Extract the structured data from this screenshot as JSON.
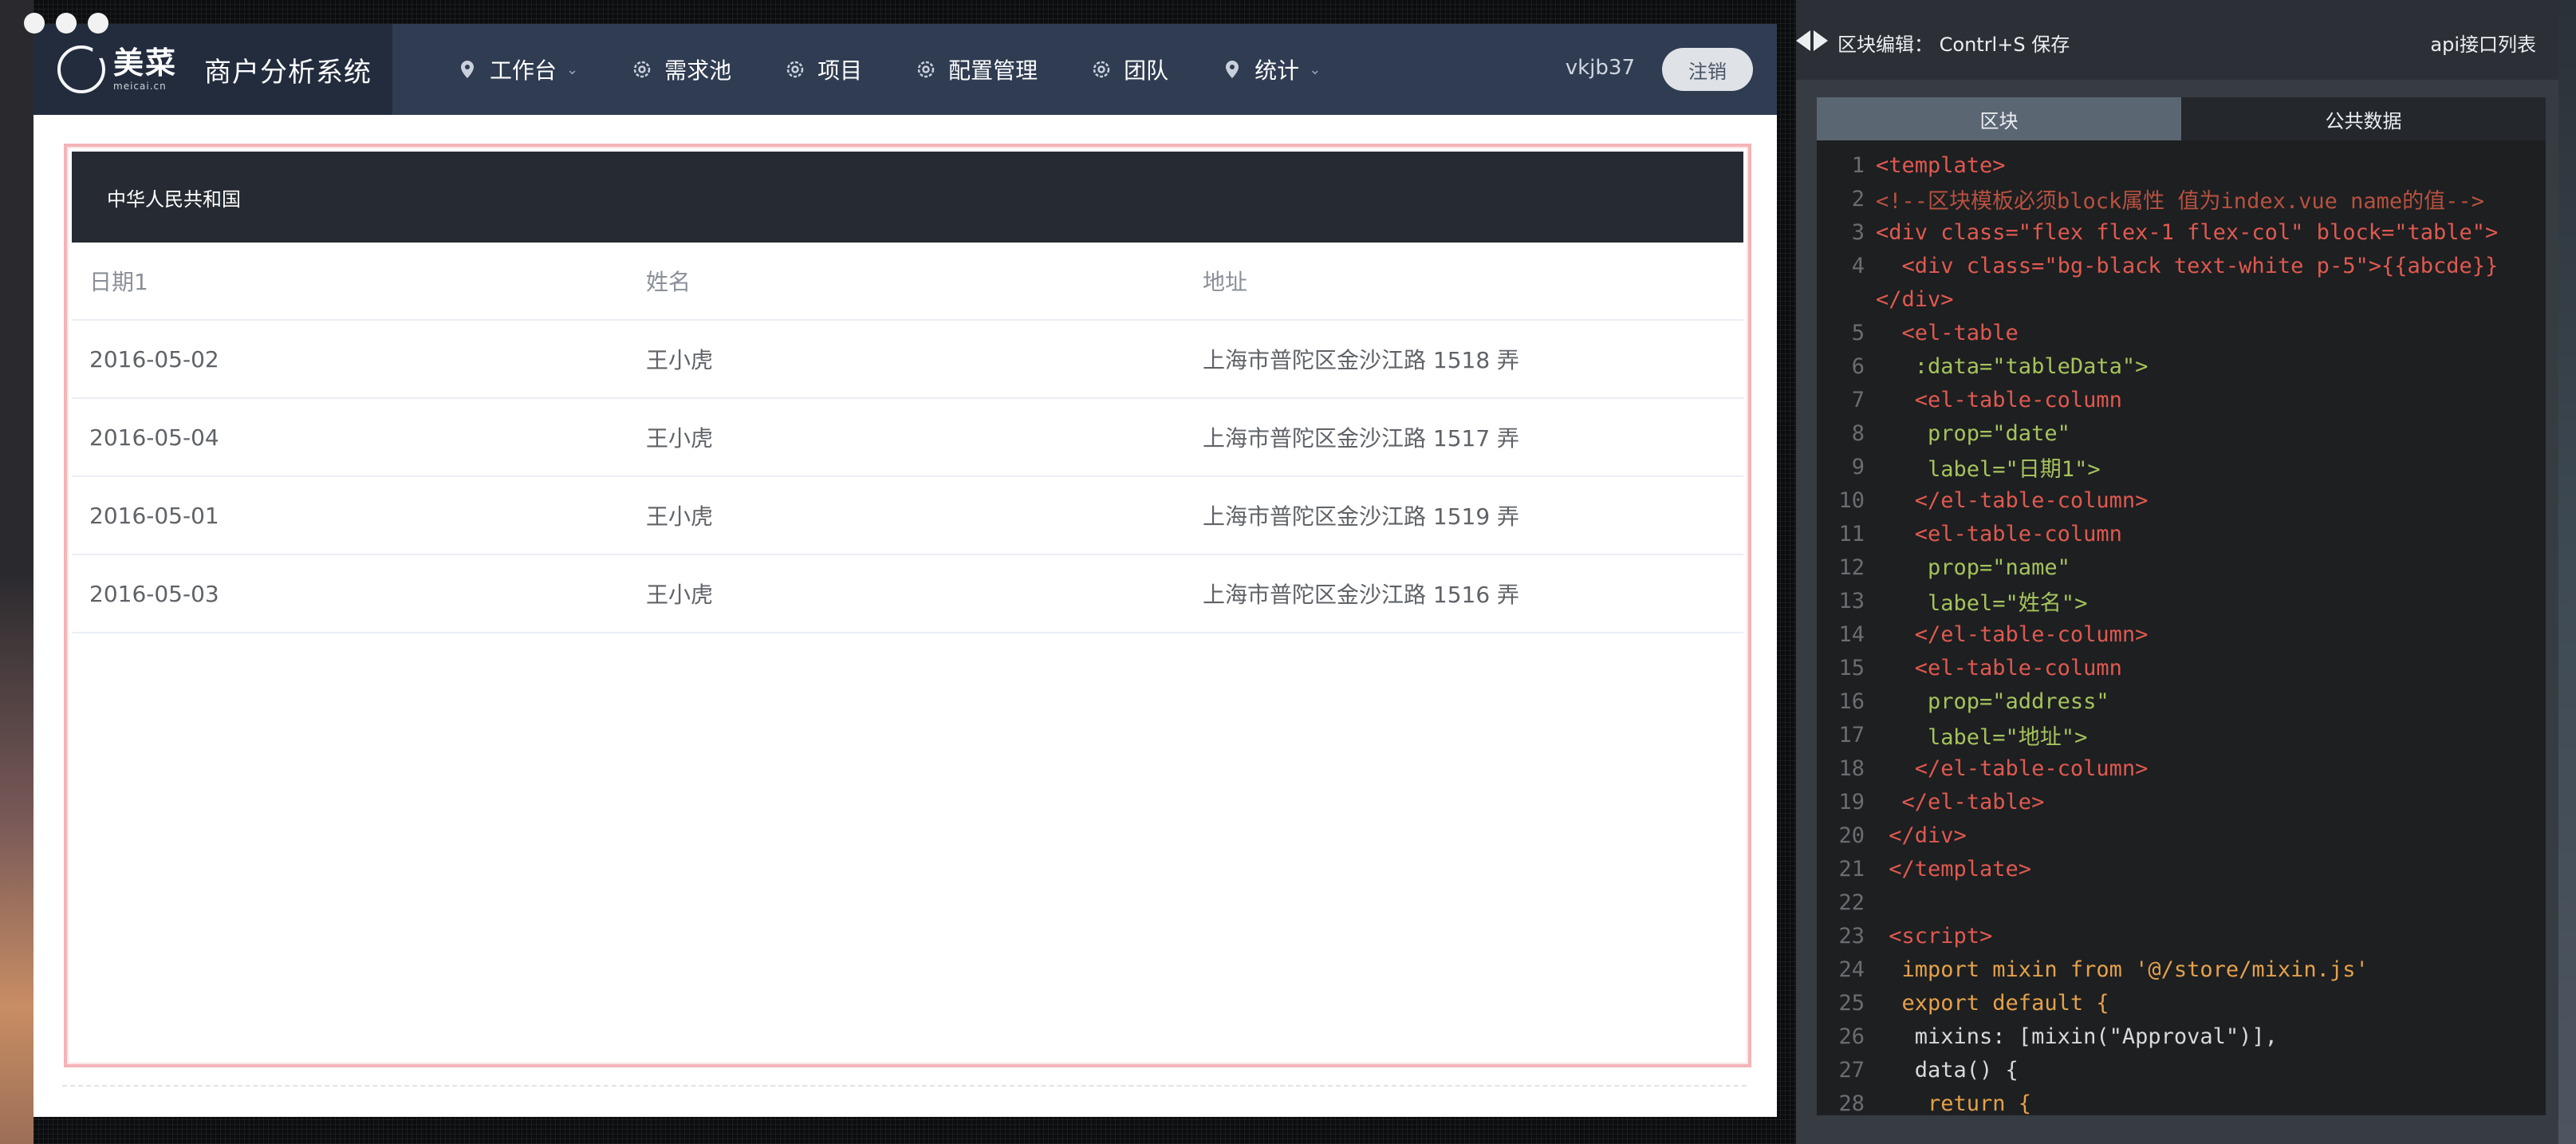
{
  "window": {
    "brand_cn": "美菜",
    "brand_en": "meicai.cn",
    "system_title": "商户分析系统"
  },
  "nav": {
    "items": [
      {
        "label": "工作台",
        "icon": "location-pin-icon",
        "dropdown": true
      },
      {
        "label": "需求池",
        "icon": "gear-icon",
        "dropdown": false
      },
      {
        "label": "项目",
        "icon": "gear-icon",
        "dropdown": false
      },
      {
        "label": "配置管理",
        "icon": "gear-icon",
        "dropdown": false
      },
      {
        "label": "团队",
        "icon": "gear-icon",
        "dropdown": false
      },
      {
        "label": "统计",
        "icon": "location-pin-icon",
        "dropdown": true
      }
    ],
    "username": "vkjb37",
    "logout_label": "注销"
  },
  "block": {
    "banner_text": "中华人民共和国",
    "table": {
      "headers": [
        "日期1",
        "姓名",
        "地址"
      ],
      "rows": [
        [
          "2016-05-02",
          "王小虎",
          "上海市普陀区金沙江路 1518 弄"
        ],
        [
          "2016-05-04",
          "王小虎",
          "上海市普陀区金沙江路 1517 弄"
        ],
        [
          "2016-05-01",
          "王小虎",
          "上海市普陀区金沙江路 1519 弄"
        ],
        [
          "2016-05-03",
          "王小虎",
          "上海市普陀区金沙江路 1516 弄"
        ]
      ]
    }
  },
  "editor": {
    "title": "区块编辑： Contrl+S 保存",
    "api_link": "api接口列表",
    "tabs": [
      "区块",
      "公共数据"
    ],
    "active_tab": "区块",
    "code_lines": [
      {
        "n": "1",
        "text": "<template>",
        "kind": "tag"
      },
      {
        "n": "2",
        "text": "<!--区块模板必须block属性 值为index.vue name的值-->",
        "kind": "cmt"
      },
      {
        "n": "3",
        "text": "<div class=\"flex flex-1 flex-col\" block=\"table\">",
        "kind": "tag"
      },
      {
        "n": "4",
        "text": "  <div class=\"bg-black text-white p-5\">{{abcde}}",
        "kind": "tag"
      },
      {
        "n": "",
        "text": "</div>",
        "kind": "tag"
      },
      {
        "n": "5",
        "text": "  <el-table",
        "kind": "tag"
      },
      {
        "n": "6",
        "text": "   :data=\"tableData\">",
        "kind": "attr"
      },
      {
        "n": "7",
        "text": "   <el-table-column",
        "kind": "tag"
      },
      {
        "n": "8",
        "text": "    prop=\"date\"",
        "kind": "attr"
      },
      {
        "n": "9",
        "text": "    label=\"日期1\">",
        "kind": "attr"
      },
      {
        "n": "10",
        "text": "   </el-table-column>",
        "kind": "tag"
      },
      {
        "n": "11",
        "text": "   <el-table-column",
        "kind": "tag"
      },
      {
        "n": "12",
        "text": "    prop=\"name\"",
        "kind": "attr"
      },
      {
        "n": "13",
        "text": "    label=\"姓名\">",
        "kind": "attr"
      },
      {
        "n": "14",
        "text": "   </el-table-column>",
        "kind": "tag"
      },
      {
        "n": "15",
        "text": "   <el-table-column",
        "kind": "tag"
      },
      {
        "n": "16",
        "text": "    prop=\"address\"",
        "kind": "attr"
      },
      {
        "n": "17",
        "text": "    label=\"地址\">",
        "kind": "attr"
      },
      {
        "n": "18",
        "text": "   </el-table-column>",
        "kind": "tag"
      },
      {
        "n": "19",
        "text": "  </el-table>",
        "kind": "tag"
      },
      {
        "n": "20",
        "text": " </div>",
        "kind": "tag"
      },
      {
        "n": "21",
        "text": " </template>",
        "kind": "tag"
      },
      {
        "n": "22",
        "text": "",
        "kind": "plain"
      },
      {
        "n": "23",
        "text": " <script>",
        "kind": "tag"
      },
      {
        "n": "24",
        "text": "  import mixin from '@/store/mixin.js'",
        "kind": "kw"
      },
      {
        "n": "25",
        "text": "  export default {",
        "kind": "kw"
      },
      {
        "n": "26",
        "text": "   mixins: [mixin(\"Approval\")],",
        "kind": "plain"
      },
      {
        "n": "27",
        "text": "   data() {",
        "kind": "plain"
      },
      {
        "n": "28",
        "text": "    return {",
        "kind": "kw"
      }
    ]
  },
  "colors": {
    "nav_bg": "#2f3c52",
    "brand_bg": "#222c3d",
    "banner_bg": "#262b33",
    "frame_border": "#f4b4b7",
    "editor_bg": "#1d1f21"
  }
}
